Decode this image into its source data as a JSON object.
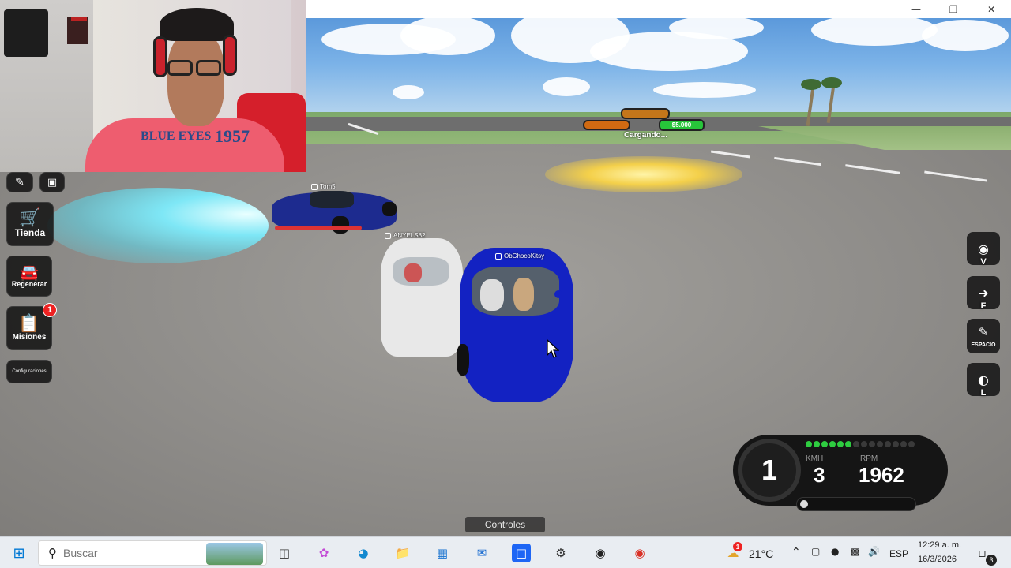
{
  "window": {
    "minimize_icon": "minimize-icon",
    "restore_icon": "restore-icon",
    "close_icon": "close-icon"
  },
  "webcam": {
    "shirt_text": "BLUE EYES",
    "shirt_number": "1957"
  },
  "hud_left": {
    "tienda_label": "Tienda",
    "regenerar_label": "Regenerar",
    "misiones_label": "Misiones",
    "misiones_badge": "1",
    "configuraciones_label": "Configuraciones"
  },
  "hud_right": {
    "camera_key": "V",
    "exit_key": "F",
    "brush_label": "ESPACIO",
    "light_key": "L"
  },
  "players": [
    {
      "name": "ANYELS82"
    },
    {
      "name": "ObChocoKitsy"
    },
    {
      "name": "Tom5"
    }
  ],
  "overhead_ui": {
    "money": "$5.000",
    "loading_text": "Cargando..."
  },
  "speedometer": {
    "gear": "1",
    "kmh_label": "KMH",
    "kmh_value": "3",
    "rpm_label": "RPM",
    "rpm_value": "1962",
    "rpm_dots_total": 14,
    "rpm_dots_lit": 6,
    "accent": "#2ecc40"
  },
  "controles_label": "Controles",
  "taskbar": {
    "search_placeholder": "Buscar",
    "weather_temp": "21°C",
    "weather_badge": "1",
    "language": "ESP",
    "time": "12:29 a. m.",
    "date": "16/3/2026",
    "notification_count": "3"
  }
}
